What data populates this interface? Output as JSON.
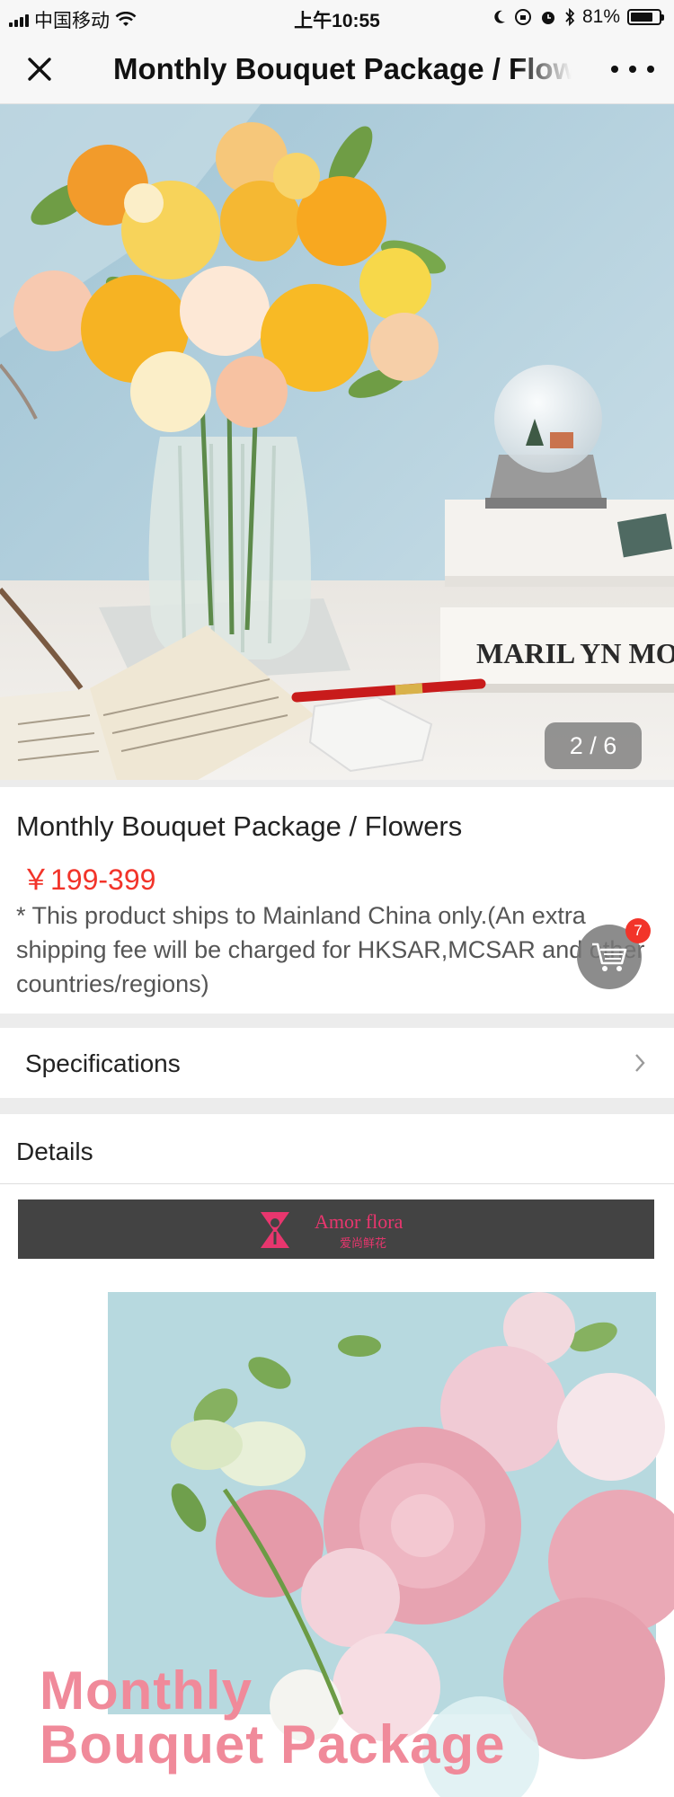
{
  "status_bar": {
    "carrier": "中国移动",
    "time": "上午10:55",
    "battery": "81%",
    "battery_level": 0.81
  },
  "nav": {
    "title": "Monthly Bouquet Package / Flowers",
    "close_icon": "close-icon",
    "more_icon": "more-icon"
  },
  "hero": {
    "image_counter": "2 / 6",
    "book_spine_text": "MARIL YN MO"
  },
  "product": {
    "title": "Monthly Bouquet Package / Flowers",
    "price": "￥199-399",
    "shipping_note": "* This product ships to Mainland China only.(An extra shipping fee will be charged for HKSAR,MCSAR and other countries/regions)"
  },
  "cart": {
    "icon": "cart-icon",
    "badge_count": "7"
  },
  "specifications": {
    "label": "Specifications",
    "icon": "chevron-right-icon"
  },
  "details": {
    "label": "Details"
  },
  "brand": {
    "name": "Amor flora",
    "subtitle": "爱尚鲜花"
  },
  "promo": {
    "line1": "Monthly",
    "line2": "Bouquet Package"
  },
  "colors": {
    "price": "#f2342a",
    "badge": "#f2342a",
    "brand": "#e8366e",
    "promo_text": "#f08a9a"
  }
}
